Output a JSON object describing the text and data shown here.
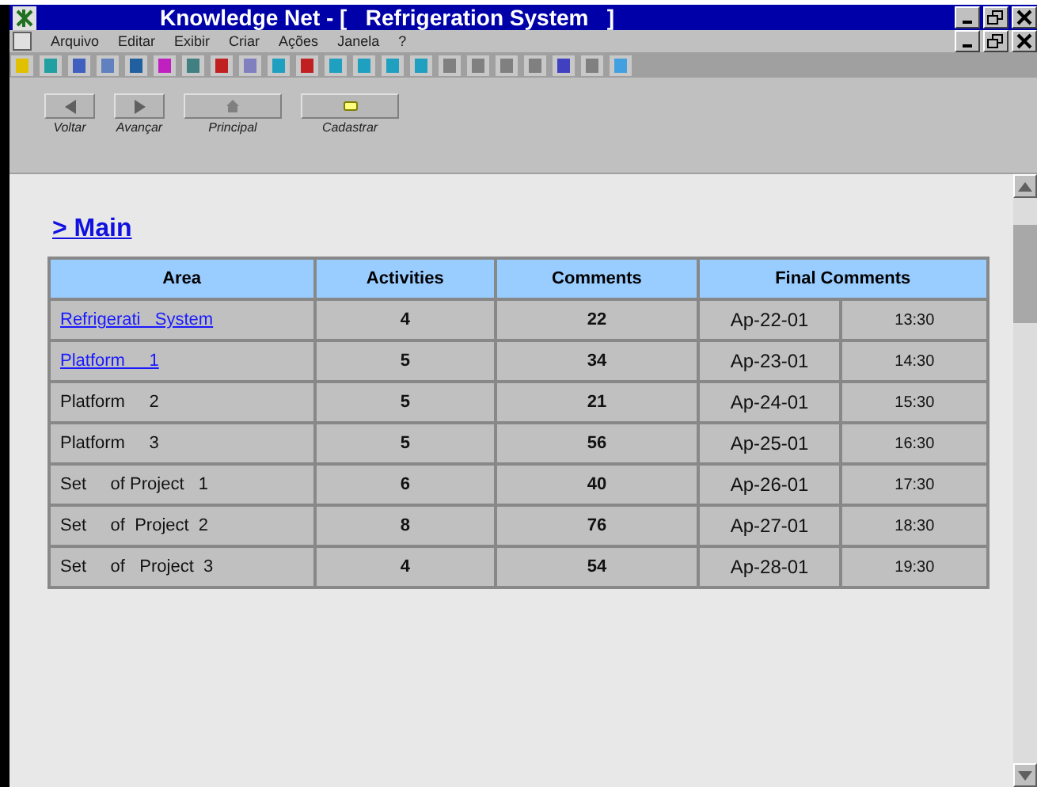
{
  "window": {
    "title": "Knowledge Net - [   Refrigeration System   ]"
  },
  "menu": [
    "Arquivo",
    "Editar",
    "Exibir",
    "Criar",
    "Ações",
    "Janela",
    "?"
  ],
  "nav_buttons": [
    {
      "kind": "back",
      "label": "Voltar"
    },
    {
      "kind": "forward",
      "label": "Avançar"
    },
    {
      "kind": "home",
      "label": "Principal"
    },
    {
      "kind": "note",
      "label": "Cadastrar"
    }
  ],
  "heading": "> Main",
  "table": {
    "columns": [
      "Area",
      "Activities",
      "Comments",
      "Final Comments"
    ],
    "rows": [
      {
        "area": "Refrigerati   System",
        "link": true,
        "activities": "4",
        "comments": "22",
        "date": "Ap-22-01",
        "time": "13:30"
      },
      {
        "area": "Platform     1",
        "link": true,
        "activities": "5",
        "comments": "34",
        "date": "Ap-23-01",
        "time": "14:30"
      },
      {
        "area": "Platform     2",
        "link": false,
        "activities": "5",
        "comments": "21",
        "date": "Ap-24-01",
        "time": "15:30"
      },
      {
        "area": "Platform     3",
        "link": false,
        "activities": "5",
        "comments": "56",
        "date": "Ap-25-01",
        "time": "16:30"
      },
      {
        "area": "Set     of Project   1",
        "link": false,
        "activities": "6",
        "comments": "40",
        "date": "Ap-26-01",
        "time": "17:30"
      },
      {
        "area": "Set     of  Project  2",
        "link": false,
        "activities": "8",
        "comments": "76",
        "date": "Ap-27-01",
        "time": "18:30"
      },
      {
        "area": "Set     of   Project  3",
        "link": false,
        "activities": "4",
        "comments": "54",
        "date": "Ap-28-01",
        "time": "19:30"
      }
    ]
  }
}
